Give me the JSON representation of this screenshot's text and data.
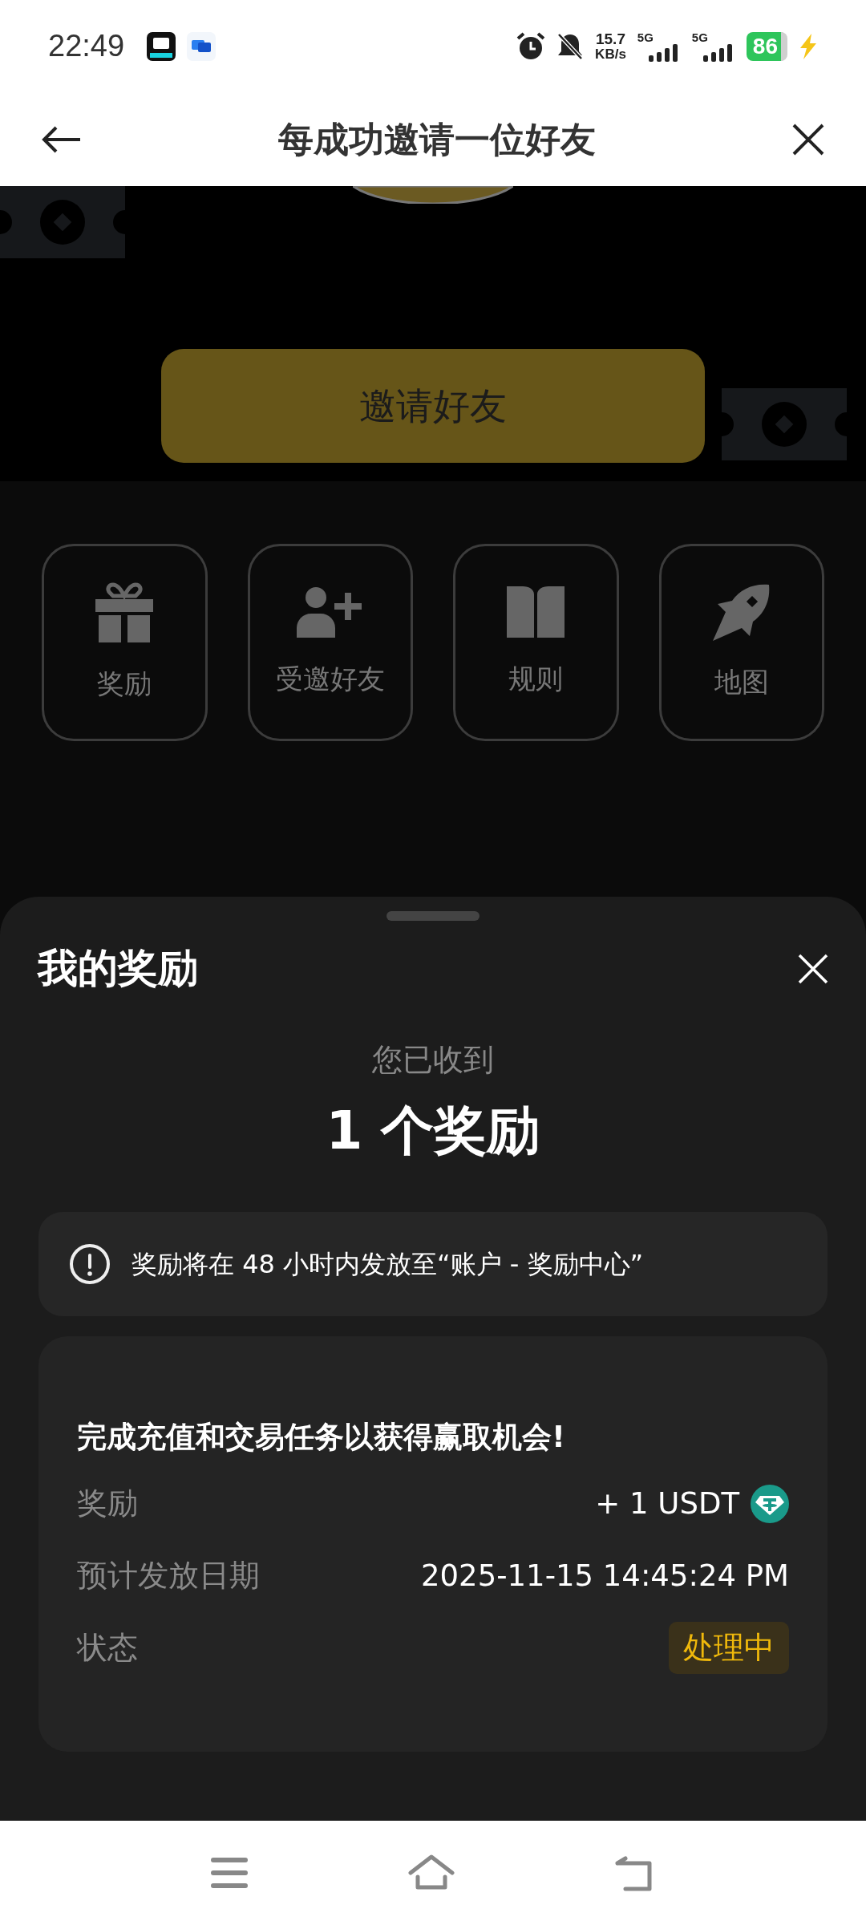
{
  "status_bar": {
    "time": "22:49",
    "net_speed": "15.7",
    "net_unit": "KB/s",
    "signals": [
      {
        "label": "5G"
      },
      {
        "label": "5G"
      }
    ],
    "battery": "86"
  },
  "header": {
    "title": "每成功邀请一位好友"
  },
  "page": {
    "invite_button": "邀请好友",
    "shortcuts": [
      {
        "label": "奖励",
        "kind": "gift"
      },
      {
        "label": "受邀好友",
        "kind": "person-add"
      },
      {
        "label": "规则",
        "kind": "book"
      },
      {
        "label": "地图",
        "kind": "rocket"
      }
    ]
  },
  "sheet": {
    "title": "我的奖励",
    "received_label": "您已收到",
    "count": "1 个奖励",
    "notice": "奖励将在 48 小时内发放至“账户 - 奖励中心”",
    "card": {
      "title": "完成充值和交易任务以获得赢取机会!",
      "rows": [
        {
          "label": "奖励",
          "value": "+ 1 USDT",
          "kind": "amount"
        },
        {
          "label": "预计发放日期",
          "value": "2025-11-15 14:45:24 PM",
          "kind": "text"
        },
        {
          "label": "状态",
          "value": "处理中",
          "kind": "badge"
        }
      ]
    }
  }
}
